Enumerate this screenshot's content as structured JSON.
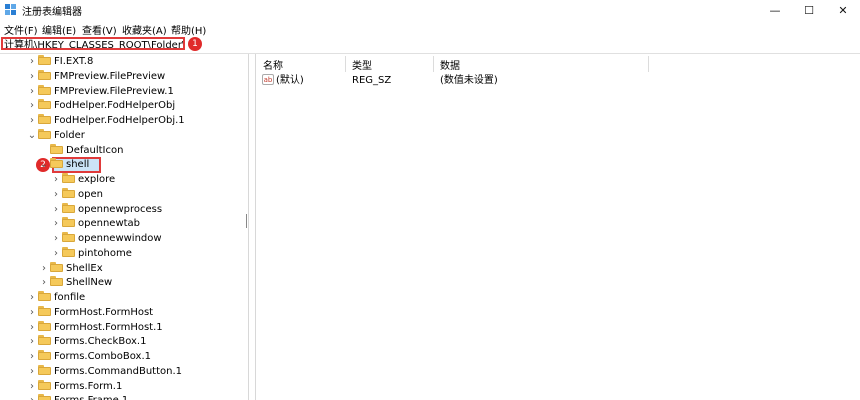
{
  "window": {
    "title": "注册表编辑器",
    "minimize_glyph": "—",
    "maximize_glyph": "☐",
    "close_glyph": "✕"
  },
  "menu": [
    "文件(F)",
    "编辑(E)",
    "查看(V)",
    "收藏夹(A)",
    "帮助(H)"
  ],
  "address": {
    "path": "计算机\\HKEY_CLASSES_ROOT\\Folder\\shell",
    "badge": "1"
  },
  "tree": {
    "selected_badge": "2",
    "items": [
      {
        "label": "FI.EXT.8",
        "chevron": "›"
      },
      {
        "label": "FMPreview.FilePreview",
        "chevron": "›"
      },
      {
        "label": "FMPreview.FilePreview.1",
        "chevron": "›"
      },
      {
        "label": "FodHelper.FodHelperObj",
        "chevron": "›"
      },
      {
        "label": "FodHelper.FodHelperObj.1",
        "chevron": "›"
      },
      {
        "label": "Folder",
        "chevron": "⌄"
      },
      {
        "label": "DefaultIcon",
        "chevron": ""
      },
      {
        "label": "shell",
        "chevron": "⌄"
      },
      {
        "label": "explore",
        "chevron": "›"
      },
      {
        "label": "open",
        "chevron": "›"
      },
      {
        "label": "opennewprocess",
        "chevron": "›"
      },
      {
        "label": "opennewtab",
        "chevron": "›"
      },
      {
        "label": "opennewwindow",
        "chevron": "›"
      },
      {
        "label": "pintohome",
        "chevron": "›"
      },
      {
        "label": "ShellEx",
        "chevron": "›"
      },
      {
        "label": "ShellNew",
        "chevron": "›"
      },
      {
        "label": "fonfile",
        "chevron": "›"
      },
      {
        "label": "FormHost.FormHost",
        "chevron": "›"
      },
      {
        "label": "FormHost.FormHost.1",
        "chevron": "›"
      },
      {
        "label": "Forms.CheckBox.1",
        "chevron": "›"
      },
      {
        "label": "Forms.ComboBox.1",
        "chevron": "›"
      },
      {
        "label": "Forms.CommandButton.1",
        "chevron": "›"
      },
      {
        "label": "Forms.Form.1",
        "chevron": "›"
      },
      {
        "label": "Forms.Frame.1",
        "chevron": "›"
      }
    ]
  },
  "list": {
    "columns": [
      "名称",
      "类型",
      "数据"
    ],
    "rows": [
      {
        "icon": "ab",
        "name": "(默认)",
        "type": "REG_SZ",
        "data": "(数值未设置)"
      }
    ]
  }
}
